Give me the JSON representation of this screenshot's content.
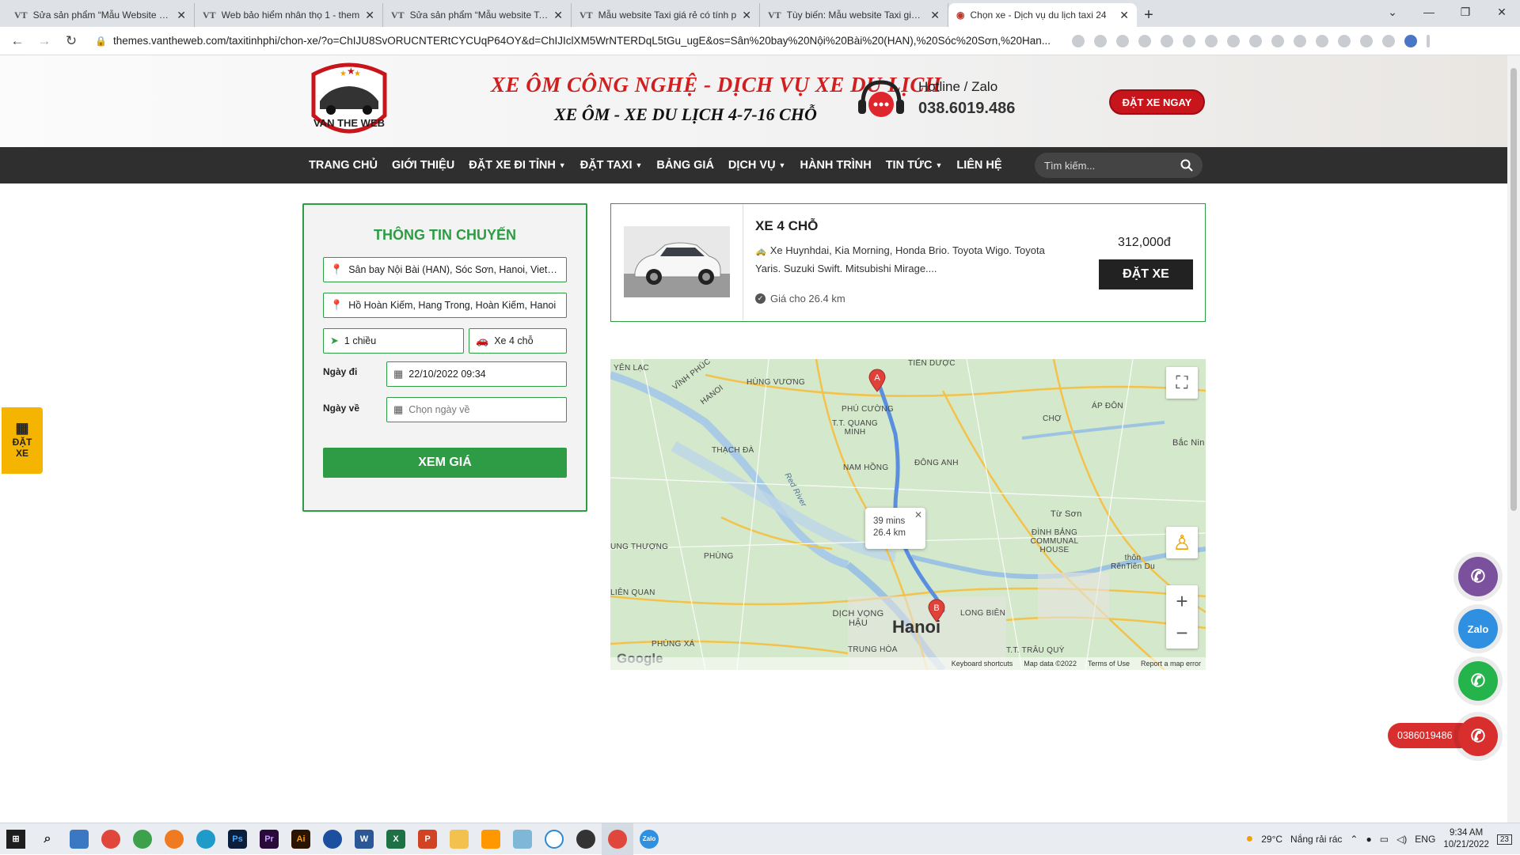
{
  "browser": {
    "tabs": [
      {
        "favicon": "VT",
        "title": "Sửa sản phẩm “Mẫu Website Vận"
      },
      {
        "favicon": "VT",
        "title": "Web bảo hiểm nhân thọ 1 - them"
      },
      {
        "favicon": "VT",
        "title": "Sửa sản phẩm “Mẫu website Taxi"
      },
      {
        "favicon": "VT",
        "title": "Mẫu website Taxi giá rẻ có tính p"
      },
      {
        "favicon": "VT",
        "title": "Tùy biến: Mẫu website Taxi giá rẻ"
      },
      {
        "favicon": "globe",
        "title": "Chọn xe - Dịch vụ du lịch taxi 24"
      }
    ],
    "url": "themes.vantheweb.com/taxitinhphi/chon-xe/?o=ChIJU8SvORUCNTERtCYCUqP64OY&d=ChIJIclXM5WrNTERDqL5tGu_ugE&os=Sân%20bay%20Nội%20Bài%20(HAN),%20Sóc%20Sơn,%20Han..."
  },
  "header": {
    "logo_text": "VAN THE WEB",
    "slogan_main": "XE ÔM CÔNG NGHỆ - DỊCH VỤ XE DU LỊCH",
    "slogan_sub": "XE ÔM - XE DU LỊCH 4-7-16 CHỖ",
    "hotline_label": "Hotline / Zalo",
    "hotline_number": "038.6019.486",
    "book_button": "ĐẶT XE NGAY"
  },
  "menu": {
    "items": [
      {
        "label": "TRANG CHỦ",
        "dropdown": false
      },
      {
        "label": "GIỚI THIỆU",
        "dropdown": false
      },
      {
        "label": "ĐẶT XE ĐI TỈNH",
        "dropdown": true
      },
      {
        "label": "ĐẶT TAXI",
        "dropdown": true
      },
      {
        "label": "BẢNG GIÁ",
        "dropdown": false
      },
      {
        "label": "DỊCH VỤ",
        "dropdown": true
      },
      {
        "label": "HÀNH TRÌNH",
        "dropdown": false
      },
      {
        "label": "TIN TỨC",
        "dropdown": true
      },
      {
        "label": "LIÊN HỆ",
        "dropdown": false
      }
    ],
    "search_placeholder": "Tìm kiếm..."
  },
  "trip": {
    "title": "THÔNG TIN CHUYẾN",
    "origin": "Sân bay Nội Bài (HAN), Sóc Sơn, Hanoi, Vietnam",
    "destination": "Hồ Hoàn Kiếm, Hang Trong, Hoàn Kiếm, Hanoi",
    "trip_type": "1 chiều",
    "car_type": "Xe 4 chỗ",
    "depart_label": "Ngày đi",
    "depart_value": "22/10/2022 09:34",
    "return_label": "Ngày về",
    "return_placeholder": "Chọn ngày về",
    "submit": "XEM GIÁ"
  },
  "car": {
    "name": "XE 4 CHỖ",
    "description": "Xe Huynhdai, Kia Morning, Honda Brio. Toyota Wigo. Toyota Yaris. Suzuki Swift. Mitsubishi Mirage....",
    "note": "Giá cho 26.4 km",
    "price": "312,000đ",
    "order_button": "ĐẶT XE"
  },
  "map": {
    "route_time": "39 mins",
    "route_distance": "26.4 km",
    "marker_a": "A",
    "marker_b": "B",
    "city_label": "Hanoi",
    "google_logo": "Google",
    "footer": [
      "Keyboard shortcuts",
      "Map data ©2022",
      "Terms of Use",
      "Report a map error"
    ],
    "place_labels": [
      "YÊN LẠC",
      "VĨNH PHÚC",
      "HANOI",
      "HÙNG VƯƠNG",
      "PHÚ CƯỜNG",
      "TIỀN DƯỢC",
      "T.T. QUANG MINH",
      "THẠCH ĐÀ",
      "NAM HỒNG",
      "ĐÔNG ANH",
      "ÁP ĐÔN",
      "CHỢ",
      "Bắc Nin",
      "Từ Sơn",
      "ĐÌNH BẢNG COMMUNAL HOUSE",
      "thôn RênTiên Du",
      "UNG THƯỢNG",
      "PHÙNG",
      "LIÊN QUAN",
      "DỊCH VỌNG HẬU",
      "TRUNG HÒA",
      "PHÙNG XÁ",
      "LONG BIÊN",
      "T.T. TRÂU QUỲ",
      "Red River"
    ]
  },
  "widgets": {
    "side_book": "ĐẶT XE",
    "phone_pill": "0386019486"
  },
  "taskbar": {
    "weather_temp": "29°C",
    "weather_text": "Nắng rải rác",
    "lang": "ENG",
    "time": "9:34 AM",
    "date": "10/21/2022",
    "notif_count": "23"
  }
}
